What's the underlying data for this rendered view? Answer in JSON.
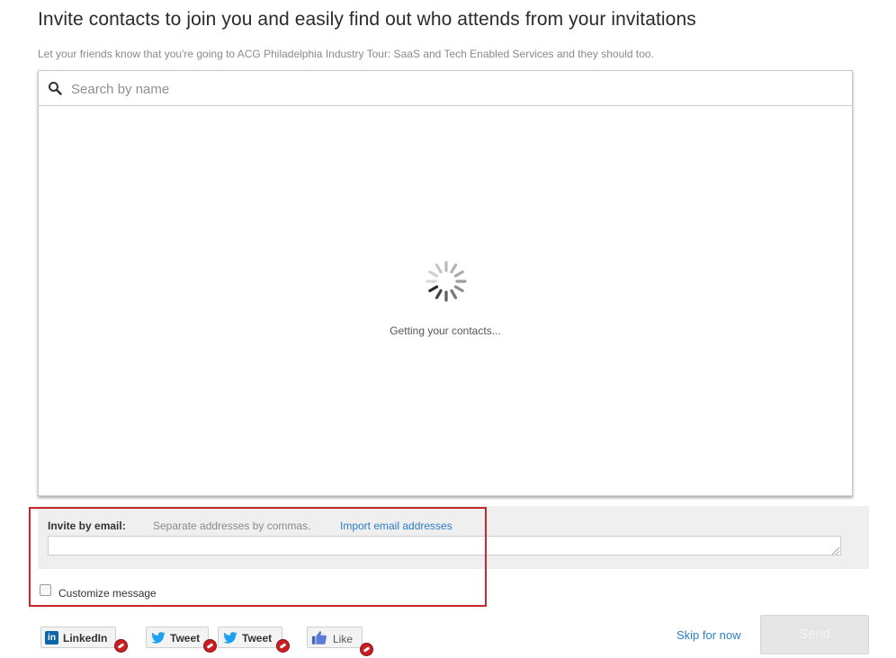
{
  "header": {
    "title": "Invite contacts to join you and easily find out who attends from your invitations",
    "subtitle": "Let your friends know that you're going to ACG Philadelphia Industry Tour: SaaS and Tech Enabled Services and they should too."
  },
  "search": {
    "placeholder": "Search by name",
    "icon": "search-icon"
  },
  "contacts": {
    "loading_text": "Getting your contacts..."
  },
  "invite_email": {
    "label": "Invite by email:",
    "hint": "Separate addresses by commas.",
    "import_link": "Import email addresses",
    "value": ""
  },
  "customize": {
    "label": "Customize message",
    "checked": false
  },
  "share": {
    "linkedin_label": "LinkedIn",
    "tweet_label_1": "Tweet",
    "tweet_label_2": "Tweet",
    "like_label": "Like",
    "linkedin_icon": "linkedin-icon",
    "twitter_icon": "twitter-bird-icon",
    "like_icon": "thumbs-up-icon"
  },
  "actions": {
    "skip_label": "Skip for now",
    "send_label": "Send"
  },
  "colors": {
    "link": "#2a7ec7",
    "highlight": "#c4282b",
    "badge": "#c91e22",
    "linkedin": "#0b66a8",
    "twitter": "#1da1f2"
  }
}
